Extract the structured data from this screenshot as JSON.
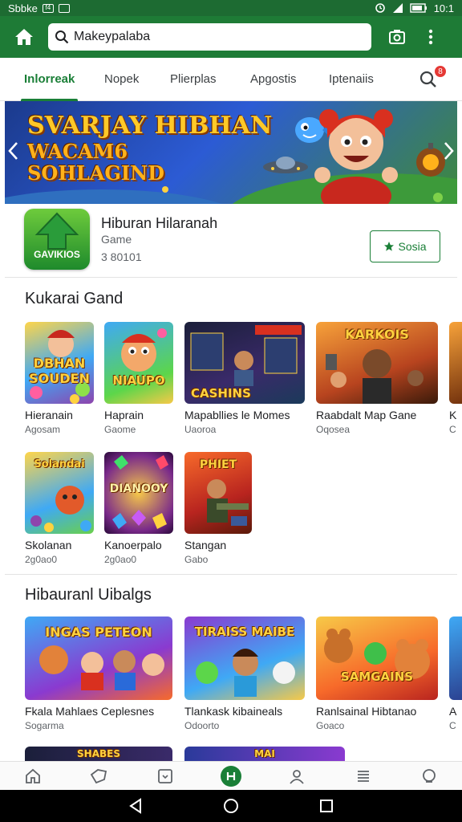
{
  "status_bar": {
    "left_text": "Sbbke",
    "left_badge": "f4",
    "time": "10:1"
  },
  "app_bar": {
    "search_value": "Makeypalaba"
  },
  "tabs": [
    {
      "label": "Inlorreak",
      "active": true
    },
    {
      "label": "Nopek",
      "active": false
    },
    {
      "label": "Plierplas",
      "active": false
    },
    {
      "label": "Apgostis",
      "active": false
    },
    {
      "label": "Iptenaiis",
      "active": false
    }
  ],
  "notification_badge": "8",
  "banner": {
    "line1": "SVARJAY HIBHAN",
    "line2": "WACAM6",
    "line3": "SOHLAGIND"
  },
  "featured": {
    "title": "Hiburan Hilaranah",
    "category": "Game",
    "meta": "3 80101",
    "get_label": "Sosia",
    "icon_label": "GAVIKIOS"
  },
  "section1": {
    "title": "Kukarai Gand",
    "row1": [
      {
        "name": "Hieranain",
        "sub": "Agosam",
        "thumb": "DBHAN SOUDEN"
      },
      {
        "name": "Haprain",
        "sub": "Gaome",
        "thumb": "NIAUPO"
      },
      {
        "name": "Mapabllies le Momes",
        "sub": "Uaoroa",
        "thumb": "CASHINS"
      },
      {
        "name": "Raabdalt Map Gane",
        "sub": "Oqosea",
        "thumb": "KARKOIS"
      },
      {
        "name": "K",
        "sub": "C",
        "thumb": ""
      }
    ],
    "row2": [
      {
        "name": "Skolanan",
        "sub": "2g0ao0",
        "thumb": "Solandai"
      },
      {
        "name": "Kanoerpalo",
        "sub": "2g0ao0",
        "thumb": "DIANOOY"
      },
      {
        "name": "Stangan",
        "sub": "Gabo",
        "thumb": "PHIET"
      }
    ]
  },
  "section2": {
    "title": "Hibauranl Uibalgs",
    "row": [
      {
        "name": "Fkala Mahlaes Ceplesnes",
        "sub": "Sogarma",
        "thumb": "INGAS PETEON"
      },
      {
        "name": "Tlankask kibaineals",
        "sub": "Odoorto",
        "thumb": "TIRAISS MAIBE"
      },
      {
        "name": "Ranlsainal Hibtanao",
        "sub": "Goaco",
        "thumb": "SAMGAINS"
      },
      {
        "name": "A",
        "sub": "C",
        "thumb": ""
      }
    ],
    "partial": [
      {
        "thumb": "SHABES"
      },
      {
        "thumb": "MAI"
      }
    ]
  },
  "colors": {
    "brand_green": "#1e7b36",
    "accent_green": "#1a7f37",
    "badge_red": "#e53935"
  },
  "icons": [
    "home-icon",
    "search-icon",
    "camera-icon",
    "more-vert-icon",
    "chevron-left-icon",
    "chevron-right-icon",
    "star-icon"
  ]
}
